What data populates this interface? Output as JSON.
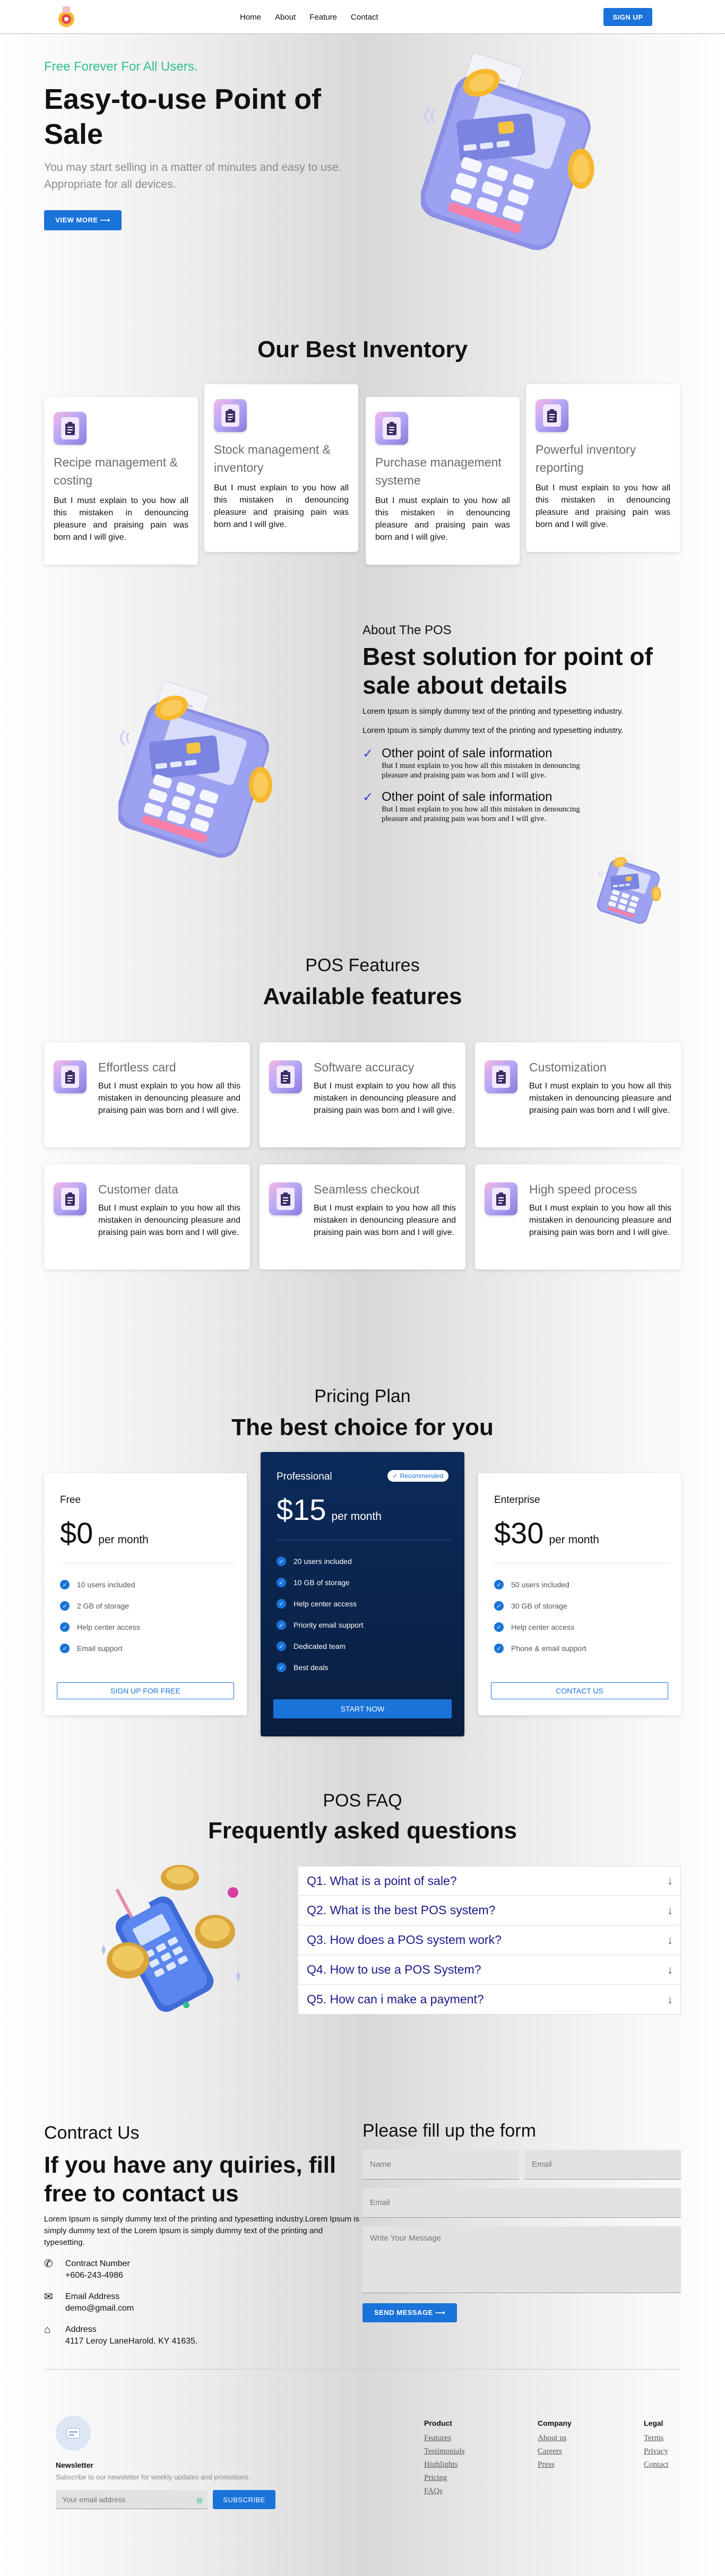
{
  "nav": {
    "links": [
      "Home",
      "About",
      "Feature",
      "Contact"
    ],
    "signup": "SIGN UP"
  },
  "hero": {
    "tag": "Free Forever For All Users.",
    "title": "Easy-to-use Point of Sale",
    "subtitle": "You may start selling in a matter of minutes and easy to use. Appropriate for all devices.",
    "cta": "VIEW MORE"
  },
  "inventory": {
    "title": "Our Best Inventory",
    "cards": [
      {
        "title": "Recipe management & costing",
        "body": "But I must explain to you how all this mistaken in denouncing pleasure and praising pain was born and I will give."
      },
      {
        "title": "Stock management & inventory",
        "body": "But I must explain to you how all this mistaken in denouncing pleasure and praising pain was born and I will give."
      },
      {
        "title": "Purchase management systeme",
        "body": "But I must explain to you how all this mistaken in denouncing pleasure and praising pain was born and I will give."
      },
      {
        "title": "Powerful inventory reporting",
        "body": "But I must explain to you how all this mistaken in denouncing pleasure and praising pain was born and I will give."
      }
    ]
  },
  "about": {
    "kicker": "About The POS",
    "title": "Best solution for point of sale about details",
    "body1": "Lorem Ipsum is simply dummy text of the printing and typesetting industry.",
    "body2": "Lorem Ipsum is simply dummy text of the printing and typesetting industry.",
    "items": [
      {
        "title": "Other point of sale information",
        "body": "But I must explain to you how all this mistaken in denouncing pleasure and praising pain was born and I will give."
      },
      {
        "title": "Other point of sale information",
        "body": "But I must explain to you how all this mistaken in denouncing pleasure and praising pain was born and I will give."
      }
    ]
  },
  "features": {
    "kicker": "POS Features",
    "title": "Available features",
    "cards": [
      {
        "title": "Effortless card",
        "body": "But I must explain to you how all this mistaken in denouncing pleasure and praising pain was born and I will give."
      },
      {
        "title": "Software accuracy",
        "body": "But I must explain to you how all this mistaken in denouncing pleasure and praising pain was born and I will give."
      },
      {
        "title": "Customization",
        "body": "But I must explain to you how all this mistaken in denouncing pleasure and praising pain was born and I will give."
      },
      {
        "title": "Customer data",
        "body": "But I must explain to you how all this mistaken in denouncing pleasure and praising pain was born and I will give."
      },
      {
        "title": "Seamless checkout",
        "body": "But I must explain to you how all this mistaken in denouncing pleasure and praising pain was born and I will give."
      },
      {
        "title": "High speed process",
        "body": "But I must explain to you how all this mistaken in denouncing pleasure and praising pain was born and I will give."
      }
    ]
  },
  "pricing": {
    "kicker": "Pricing Plan",
    "title": "The best choice for you",
    "plans": [
      {
        "name": "Free",
        "price": "$0",
        "per": "per month",
        "features": [
          "10 users included",
          "2 GB of storage",
          "Help center access",
          "Email support"
        ],
        "cta": "SIGN UP FOR FREE"
      },
      {
        "name": "Professional",
        "badge": "Recommended",
        "price": "$15",
        "per": "per month",
        "features": [
          "20 users included",
          "10 GB of storage",
          "Help center access",
          "Priority email support",
          "Dedicated team",
          "Best deals"
        ],
        "cta": "START NOW"
      },
      {
        "name": "Enterprise",
        "price": "$30",
        "per": "per month",
        "features": [
          "50 users included",
          "30 GB of storage",
          "Help center access",
          "Phone & email support"
        ],
        "cta": "CONTACT US"
      }
    ]
  },
  "faq": {
    "kicker": "POS FAQ",
    "title": "Frequently asked questions",
    "items": [
      "Q1. What is a point of sale?",
      "Q2. What is the best POS system?",
      "Q3. How does a POS system work?",
      "Q4. How to use a POS System?",
      "Q5. How can i make a payment?"
    ]
  },
  "contact": {
    "kicker": "Contract Us",
    "title": "If you have any quiries, fill free to contact us",
    "body": "Lorem Ipsum is simply dummy text of the printing and typesetting industry.Lorem Ipsum is simply dummy text of the Lorem Ipsum is simply dummy text of the printing and typesetting.",
    "phone_label": "Contract Number",
    "phone": "+606-243-4986",
    "email_label": "Email Address",
    "email": "demo@gmail.com",
    "address_label": "Address",
    "address": "4117 Leroy LaneHarold, KY 41635.",
    "form_title": "Please fill up the form",
    "name_ph": "Name",
    "email_ph": "Email",
    "email2_ph": "Email",
    "message_ph": "Write Your Message",
    "send": "SEND MESSAGE"
  },
  "footer": {
    "newsletter_title": "Newsletter",
    "newsletter_sub": "Subscribe to our newsletter for weekly updates and promotions.",
    "newsletter_ph": "Your email address",
    "subscribe": "SUBSCRIBE",
    "cols": [
      {
        "title": "Product",
        "links": [
          "Features",
          "Testimonials",
          "Highlights",
          "Pricing",
          "FAQs"
        ]
      },
      {
        "title": "Company",
        "links": [
          "About us",
          "Careers",
          "Press"
        ]
      },
      {
        "title": "Legal",
        "links": [
          "Terms",
          "Privacy",
          "Contact"
        ]
      }
    ]
  }
}
